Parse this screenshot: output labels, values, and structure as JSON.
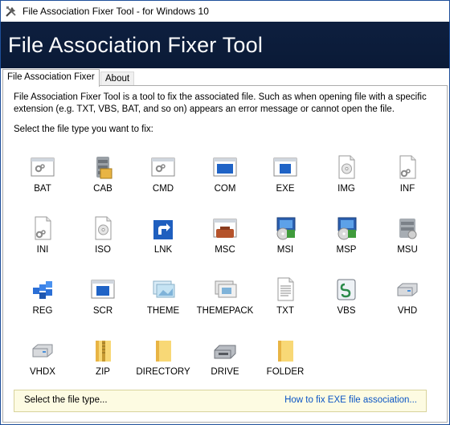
{
  "window": {
    "title": "File Association Fixer Tool - for Windows 10"
  },
  "banner": {
    "title": "File Association Fixer Tool"
  },
  "tabs": [
    {
      "label": "File Association Fixer",
      "active": true
    },
    {
      "label": "About",
      "active": false
    }
  ],
  "main": {
    "description": "File Association Fixer Tool is a tool to fix the associated file. Such as when opening file with a specific extension (e.g. TXT, VBS, BAT, and so on) appears an error message or cannot open the file.",
    "prompt": "Select the file type you want to fix:"
  },
  "file_types": [
    {
      "label": "BAT",
      "icon": "batch-file-icon"
    },
    {
      "label": "CAB",
      "icon": "cabinet-file-icon"
    },
    {
      "label": "CMD",
      "icon": "cmd-file-icon"
    },
    {
      "label": "COM",
      "icon": "com-file-icon"
    },
    {
      "label": "EXE",
      "icon": "exe-file-icon"
    },
    {
      "label": "IMG",
      "icon": "disc-image-file-icon"
    },
    {
      "label": "INF",
      "icon": "inf-file-icon"
    },
    {
      "label": "INI",
      "icon": "ini-file-icon"
    },
    {
      "label": "ISO",
      "icon": "iso-file-icon"
    },
    {
      "label": "LNK",
      "icon": "shortcut-icon"
    },
    {
      "label": "MSC",
      "icon": "management-console-icon"
    },
    {
      "label": "MSI",
      "icon": "installer-icon"
    },
    {
      "label": "MSP",
      "icon": "installer-patch-icon"
    },
    {
      "label": "MSU",
      "icon": "update-package-icon"
    },
    {
      "label": "REG",
      "icon": "registry-icon"
    },
    {
      "label": "SCR",
      "icon": "screensaver-icon"
    },
    {
      "label": "THEME",
      "icon": "theme-icon"
    },
    {
      "label": "THEMEPACK",
      "icon": "themepack-icon"
    },
    {
      "label": "TXT",
      "icon": "text-file-icon"
    },
    {
      "label": "VBS",
      "icon": "script-file-icon"
    },
    {
      "label": "VHD",
      "icon": "virtual-disk-icon"
    },
    {
      "label": "VHDX",
      "icon": "virtual-disk-x-icon"
    },
    {
      "label": "ZIP",
      "icon": "zip-folder-icon"
    },
    {
      "label": "DIRECTORY",
      "icon": "directory-icon"
    },
    {
      "label": "DRIVE",
      "icon": "drive-icon"
    },
    {
      "label": "FOLDER",
      "icon": "folder-icon"
    }
  ],
  "status": {
    "text": "Select the file type...",
    "link": "How to fix EXE file association..."
  },
  "colors": {
    "banner": "#0e1f3f",
    "link": "#0b55c4",
    "status_bg": "#fdfbe2",
    "folder": "#f4c95d"
  }
}
